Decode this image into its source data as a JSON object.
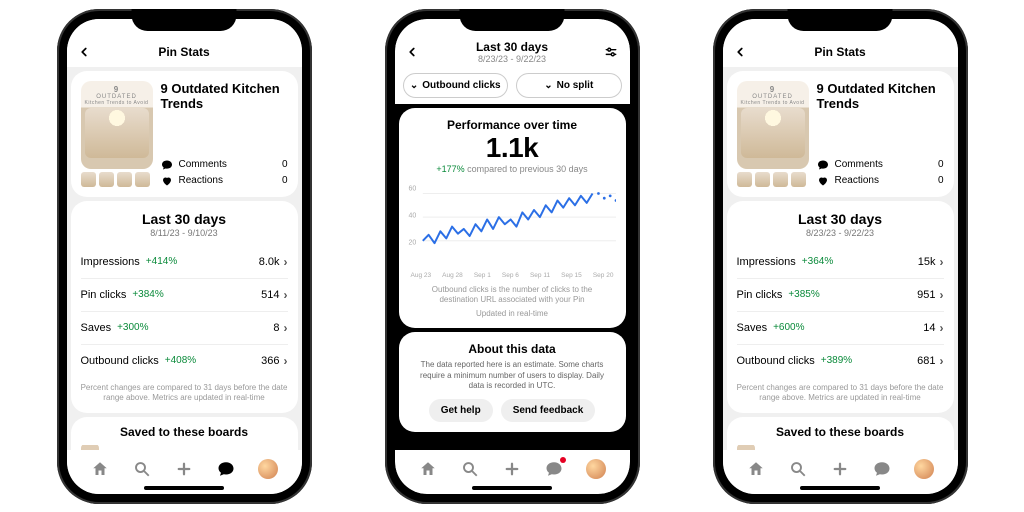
{
  "phones": [
    {
      "header": {
        "title": "Pin Stats"
      },
      "pin": {
        "thumb_top_num": "9",
        "thumb_top_word": "OUTDATED",
        "thumb_top_sub": "Kitchen Trends to Avoid",
        "title": "9 Outdated Kitchen Trends",
        "comments_label": "Comments",
        "comments_value": "0",
        "reactions_label": "Reactions",
        "reactions_value": "0"
      },
      "range": {
        "title": "Last 30 days",
        "range": "8/11/23 - 9/10/23",
        "metrics": [
          {
            "label": "Impressions",
            "pct": "+414%",
            "value": "8.0k"
          },
          {
            "label": "Pin clicks",
            "pct": "+384%",
            "value": "514"
          },
          {
            "label": "Saves",
            "pct": "+300%",
            "value": "8"
          },
          {
            "label": "Outbound clicks",
            "pct": "+408%",
            "value": "366"
          }
        ],
        "footnote": "Percent changes are compared to 31 days before the date range above. Metrics are updated in real-time"
      },
      "saved": {
        "title": "Saved to these boards"
      },
      "nav_active": 3
    },
    {
      "header": {
        "title": "Last 30 days",
        "sub": "8/23/23 - 9/22/23"
      },
      "pills": {
        "metric": "Outbound clicks",
        "split": "No split"
      },
      "perf": {
        "title": "Performance over time",
        "big": "1.1k",
        "pct": "+177%",
        "pct_suffix": "compared to previous 30 days"
      },
      "chart_data": {
        "type": "line",
        "xlabel": "",
        "ylabel": "",
        "ylim": [
          0,
          60
        ],
        "yticks": [
          20,
          40,
          60
        ],
        "x": [
          "Aug 23",
          "Aug 28",
          "Sep 1",
          "Sep 6",
          "Sep 11",
          "Sep 15",
          "Sep 20"
        ],
        "values": [
          20,
          25,
          18,
          28,
          22,
          32,
          26,
          30,
          24,
          34,
          28,
          38,
          30,
          40,
          34,
          38,
          32,
          44,
          38,
          46,
          40,
          50,
          44,
          54,
          48,
          56,
          50,
          58,
          52,
          60
        ],
        "dotted_tail": [
          60,
          56,
          58,
          54
        ],
        "desc": "Outbound clicks is the number of clicks to the destination URL associated with your Pin",
        "updated": "Updated in real-time"
      },
      "about": {
        "title": "About this data",
        "desc": "The data reported here is an estimate. Some charts require a minimum number of users to display. Daily data is recorded in UTC.",
        "help": "Get help",
        "feedback": "Send feedback"
      },
      "nav_active": -1,
      "nav_dot": 3
    },
    {
      "header": {
        "title": "Pin Stats"
      },
      "pin": {
        "thumb_top_num": "9",
        "thumb_top_word": "OUTDATED",
        "thumb_top_sub": "Kitchen Trends to Avoid",
        "title": "9 Outdated Kitchen Trends",
        "comments_label": "Comments",
        "comments_value": "0",
        "reactions_label": "Reactions",
        "reactions_value": "0"
      },
      "range": {
        "title": "Last 30 days",
        "range": "8/23/23 - 9/22/23",
        "metrics": [
          {
            "label": "Impressions",
            "pct": "+364%",
            "value": "15k"
          },
          {
            "label": "Pin clicks",
            "pct": "+385%",
            "value": "951"
          },
          {
            "label": "Saves",
            "pct": "+600%",
            "value": "14"
          },
          {
            "label": "Outbound clicks",
            "pct": "+389%",
            "value": "681"
          }
        ],
        "footnote": "Percent changes are compared to 31 days before the date range above. Metrics are updated in real-time"
      },
      "saved": {
        "title": "Saved to these boards"
      },
      "nav_active": -1
    }
  ]
}
